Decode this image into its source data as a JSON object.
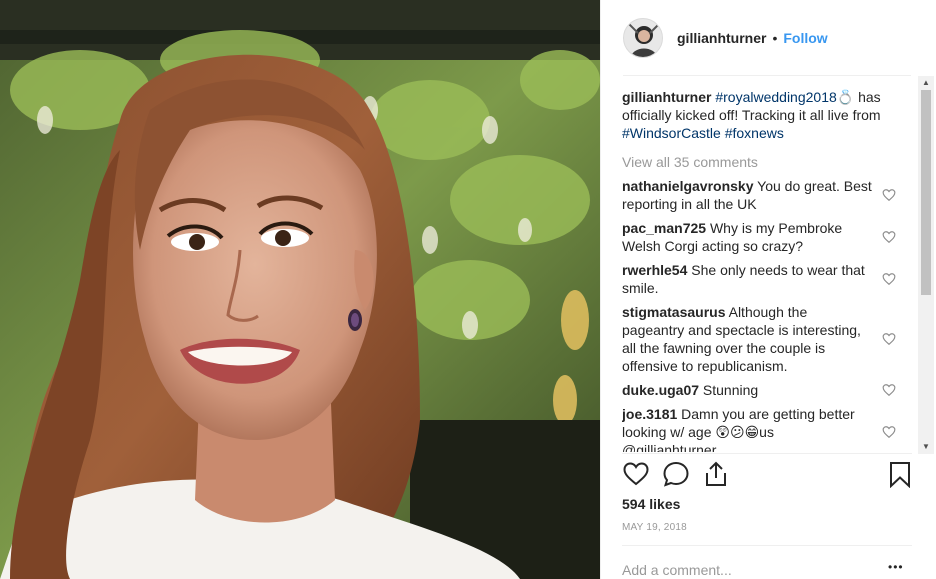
{
  "post": {
    "username": "gillianhturner",
    "separator": "•",
    "follow_label": "Follow",
    "caption": {
      "username": "gillianhturner",
      "hashtag1": "#royalwedding2018",
      "emoji": "💍",
      "text1": " has officially kicked off! Tracking it all live from ",
      "hashtag2": "#WindsorCastle",
      "hashtag3": "#foxnews"
    },
    "view_all_label": "View all 35 comments",
    "comments": [
      {
        "user": "nathanielgavronsky",
        "text": "You do great. Best reporting in all the UK"
      },
      {
        "user": "pac_man725",
        "text": "Why is my Pembroke Welsh Corgi acting so crazy?"
      },
      {
        "user": "rwerhle54",
        "text": "She only needs to wear that smile."
      },
      {
        "user": "stigmatasaurus",
        "text": "Although the pageantry and spectacle is interesting, all the fawning over the couple is offensive to republicanism."
      },
      {
        "user": "duke.uga07",
        "text": "Stunning"
      },
      {
        "user": "joe.3181",
        "text": "Damn you are getting better looking w/ age 😲😕😁us @gillianhturner"
      }
    ],
    "likes": "594 likes",
    "date": "MAY 19, 2018",
    "add_comment_placeholder": "Add a comment...",
    "more_label": "•••",
    "icons": [
      "heart-icon",
      "comment-icon",
      "share-icon",
      "bookmark-icon",
      "like-comment-heart-icon"
    ],
    "colors": {
      "link": "#003569",
      "follow": "#3897f0",
      "muted": "#999999"
    }
  }
}
